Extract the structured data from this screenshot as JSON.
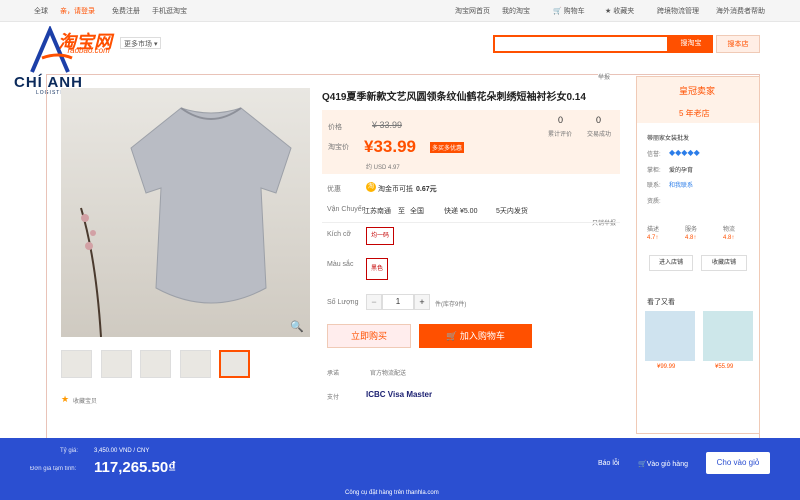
{
  "topbar": {
    "region": "全球",
    "welcome": "亲，请登录",
    "signup": "免费注册",
    "mobile": "手机逛淘宝",
    "home": "淘宝网首页",
    "my": "我的淘宝",
    "cart": "购物车",
    "fav": "收藏夹",
    "cross": "跨境物流管理",
    "overseas": "海外消费者帮助"
  },
  "header": {
    "logo": "淘宝网",
    "logo_sub": "Taobao.com",
    "more": "更多市场",
    "search_btn": "搜淘宝",
    "store_btn": "搜本店"
  },
  "watermark": {
    "name": "CHÍ ANH",
    "sub": "LOGISTICS"
  },
  "product": {
    "title": "Q419夏季新款文艺风圆领条纹仙鹤花朵刺绣短袖衬衫女0.14",
    "price_label": "价格",
    "old_price": "¥ 33.99",
    "tb_label": "淘宝价",
    "price": "¥33.99",
    "promo": "多买多优惠",
    "usd": "约 USD 4.97",
    "reviews_label": "累计评价",
    "reviews": "0",
    "trades_label": "交易成功",
    "trades": "0",
    "youhui_label": "优惠",
    "youhui": "淘金币可抵",
    "youhui_val": "0.67元",
    "ship_label": "Vận Chuyển",
    "ship_from": "江苏南通",
    "ship_to": "至",
    "ship_dest": "全国",
    "ship_fee": "快递 ¥5.00",
    "ship_time": "5天内发货",
    "report": "只销举报",
    "size_label": "Kích cỡ",
    "size_opt": "均一码",
    "color_label": "Màu sắc",
    "color_opt": "黑色",
    "qty_label": "Số Lượng",
    "qty_minus": "−",
    "qty": "1",
    "qty_plus": "+",
    "stock": "件(库存9件)",
    "buy_now": "立即购买",
    "add_cart": "加入购物车",
    "guarantee_label": "承诺",
    "guarantee": "官方物流配送",
    "pay_label": "支付",
    "pay_methods": "ICBC  Visa  Master",
    "fav": "收藏宝贝",
    "scale_mark": "举报"
  },
  "seller": {
    "badge": "皇冠卖家",
    "years": "5 年老店",
    "shop_name": "蒂丽家女装批发",
    "rating_label": "信誉:",
    "seller_label": "掌柜:",
    "seller": "爱的孕育",
    "contact_label": "联系:",
    "contact": "和我联系",
    "qual_label": "资质:",
    "score_label": "描述",
    "service_label": "服务",
    "logistics_label": "物流",
    "score1": "4.7↑",
    "score2": "4.8↑",
    "score3": "4.8↑",
    "enter_shop": "进入店铺",
    "fav_shop": "收藏店铺",
    "also_viewed": "看了又看",
    "rec1_price": "¥99.99",
    "rec2_price": "¥55.99"
  },
  "bottombar": {
    "rate_label": "Tỷ giá:",
    "rate": "3,450.00 VND / CNY",
    "unit_label": "Đơn giá tạm tính:",
    "unit_price": "117,265.50₫",
    "report": "Báo lỗi",
    "cart": "Vào giỏ hàng",
    "add": "Cho vào giỏ",
    "footer": "Công cụ đặt hàng trên thanhla.com"
  },
  "colors": {
    "accent": "#ff5000",
    "bar": "#2b4fd1"
  }
}
